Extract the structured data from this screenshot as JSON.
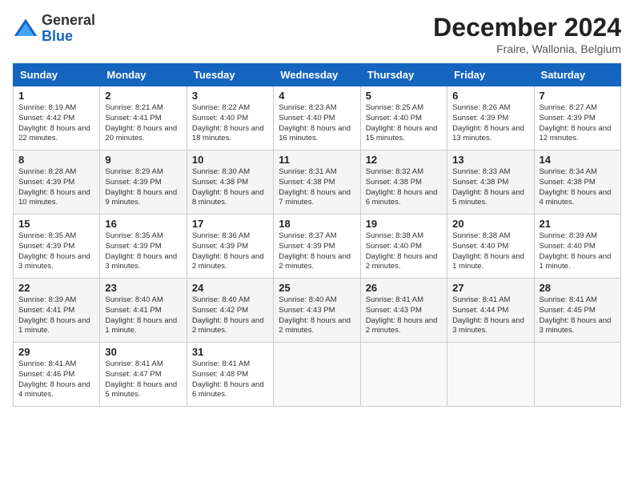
{
  "logo": {
    "general": "General",
    "blue": "Blue"
  },
  "title": "December 2024",
  "location": "Fraire, Wallonia, Belgium",
  "days_of_week": [
    "Sunday",
    "Monday",
    "Tuesday",
    "Wednesday",
    "Thursday",
    "Friday",
    "Saturday"
  ],
  "weeks": [
    [
      {
        "day": 1,
        "rise": "8:19 AM",
        "set": "4:42 PM",
        "daylight": "8 hours and 22 minutes."
      },
      {
        "day": 2,
        "rise": "8:21 AM",
        "set": "4:41 PM",
        "daylight": "8 hours and 20 minutes."
      },
      {
        "day": 3,
        "rise": "8:22 AM",
        "set": "4:40 PM",
        "daylight": "8 hours and 18 minutes."
      },
      {
        "day": 4,
        "rise": "8:23 AM",
        "set": "4:40 PM",
        "daylight": "8 hours and 16 minutes."
      },
      {
        "day": 5,
        "rise": "8:25 AM",
        "set": "4:40 PM",
        "daylight": "8 hours and 15 minutes."
      },
      {
        "day": 6,
        "rise": "8:26 AM",
        "set": "4:39 PM",
        "daylight": "8 hours and 13 minutes."
      },
      {
        "day": 7,
        "rise": "8:27 AM",
        "set": "4:39 PM",
        "daylight": "8 hours and 12 minutes."
      }
    ],
    [
      {
        "day": 8,
        "rise": "8:28 AM",
        "set": "4:39 PM",
        "daylight": "8 hours and 10 minutes."
      },
      {
        "day": 9,
        "rise": "8:29 AM",
        "set": "4:39 PM",
        "daylight": "8 hours and 9 minutes."
      },
      {
        "day": 10,
        "rise": "8:30 AM",
        "set": "4:38 PM",
        "daylight": "8 hours and 8 minutes."
      },
      {
        "day": 11,
        "rise": "8:31 AM",
        "set": "4:38 PM",
        "daylight": "8 hours and 7 minutes."
      },
      {
        "day": 12,
        "rise": "8:32 AM",
        "set": "4:38 PM",
        "daylight": "8 hours and 6 minutes."
      },
      {
        "day": 13,
        "rise": "8:33 AM",
        "set": "4:38 PM",
        "daylight": "8 hours and 5 minutes."
      },
      {
        "day": 14,
        "rise": "8:34 AM",
        "set": "4:38 PM",
        "daylight": "8 hours and 4 minutes."
      }
    ],
    [
      {
        "day": 15,
        "rise": "8:35 AM",
        "set": "4:39 PM",
        "daylight": "8 hours and 3 minutes."
      },
      {
        "day": 16,
        "rise": "8:35 AM",
        "set": "4:39 PM",
        "daylight": "8 hours and 3 minutes."
      },
      {
        "day": 17,
        "rise": "8:36 AM",
        "set": "4:39 PM",
        "daylight": "8 hours and 2 minutes."
      },
      {
        "day": 18,
        "rise": "8:37 AM",
        "set": "4:39 PM",
        "daylight": "8 hours and 2 minutes."
      },
      {
        "day": 19,
        "rise": "8:38 AM",
        "set": "4:40 PM",
        "daylight": "8 hours and 2 minutes."
      },
      {
        "day": 20,
        "rise": "8:38 AM",
        "set": "4:40 PM",
        "daylight": "8 hours and 1 minute."
      },
      {
        "day": 21,
        "rise": "8:39 AM",
        "set": "4:40 PM",
        "daylight": "8 hours and 1 minute."
      }
    ],
    [
      {
        "day": 22,
        "rise": "8:39 AM",
        "set": "4:41 PM",
        "daylight": "8 hours and 1 minute."
      },
      {
        "day": 23,
        "rise": "8:40 AM",
        "set": "4:41 PM",
        "daylight": "8 hours and 1 minute."
      },
      {
        "day": 24,
        "rise": "8:40 AM",
        "set": "4:42 PM",
        "daylight": "8 hours and 2 minutes."
      },
      {
        "day": 25,
        "rise": "8:40 AM",
        "set": "4:43 PM",
        "daylight": "8 hours and 2 minutes."
      },
      {
        "day": 26,
        "rise": "8:41 AM",
        "set": "4:43 PM",
        "daylight": "8 hours and 2 minutes."
      },
      {
        "day": 27,
        "rise": "8:41 AM",
        "set": "4:44 PM",
        "daylight": "8 hours and 3 minutes."
      },
      {
        "day": 28,
        "rise": "8:41 AM",
        "set": "4:45 PM",
        "daylight": "8 hours and 3 minutes."
      }
    ],
    [
      {
        "day": 29,
        "rise": "8:41 AM",
        "set": "4:46 PM",
        "daylight": "8 hours and 4 minutes."
      },
      {
        "day": 30,
        "rise": "8:41 AM",
        "set": "4:47 PM",
        "daylight": "8 hours and 5 minutes."
      },
      {
        "day": 31,
        "rise": "8:41 AM",
        "set": "4:48 PM",
        "daylight": "8 hours and 6 minutes."
      },
      null,
      null,
      null,
      null
    ]
  ]
}
